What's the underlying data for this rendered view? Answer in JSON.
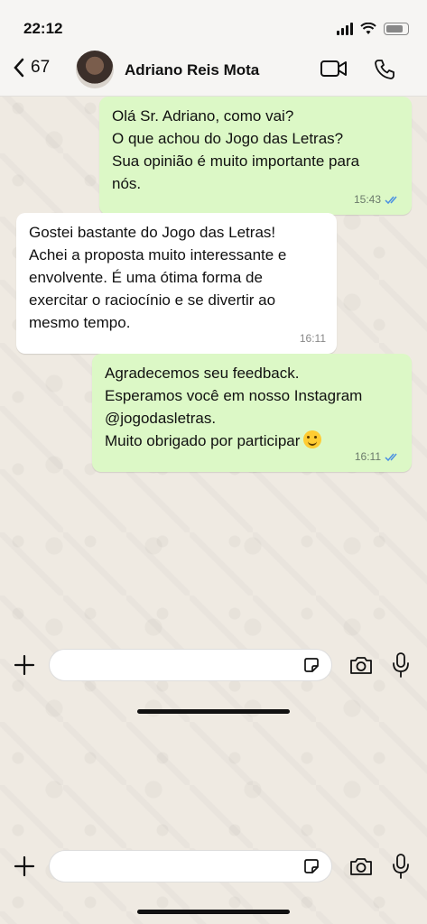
{
  "status_bar": {
    "time": "22:12"
  },
  "header": {
    "back_count": "67",
    "contact_name": "Adriano Reis Mota"
  },
  "messages": [
    {
      "direction": "outgoing",
      "lines": [
        "Olá Sr. Adriano, como vai?",
        "O que achou do Jogo das Letras?",
        "Sua opinião é muito importante para",
        "nós."
      ],
      "time": "15:43",
      "status": "read"
    },
    {
      "direction": "incoming",
      "lines": [
        "Gostei bastante do Jogo das Letras!",
        "Achei a proposta muito interessante e",
        "envolvente. É uma ótima forma de",
        "exercitar o raciocínio e se divertir ao",
        "mesmo tempo."
      ],
      "time": "16:11"
    },
    {
      "direction": "outgoing",
      "lines": [
        "Agradecemos seu feedback.",
        "Esperamos você em nosso Instagram",
        "@jogodasletras.",
        "Muito obrigado por participar"
      ],
      "emoji": "smiling-face-emoji",
      "time": "16:11",
      "status": "read"
    }
  ],
  "input_bar": {
    "icons": [
      "plus-icon",
      "sticker-icon",
      "camera-icon",
      "microphone-icon"
    ],
    "message_value": ""
  },
  "colors": {
    "outgoing_bubble": "#dcf8c6",
    "incoming_bubble": "#ffffff",
    "chat_background": "#efeae2",
    "read_ticks": "#4a90e2"
  }
}
